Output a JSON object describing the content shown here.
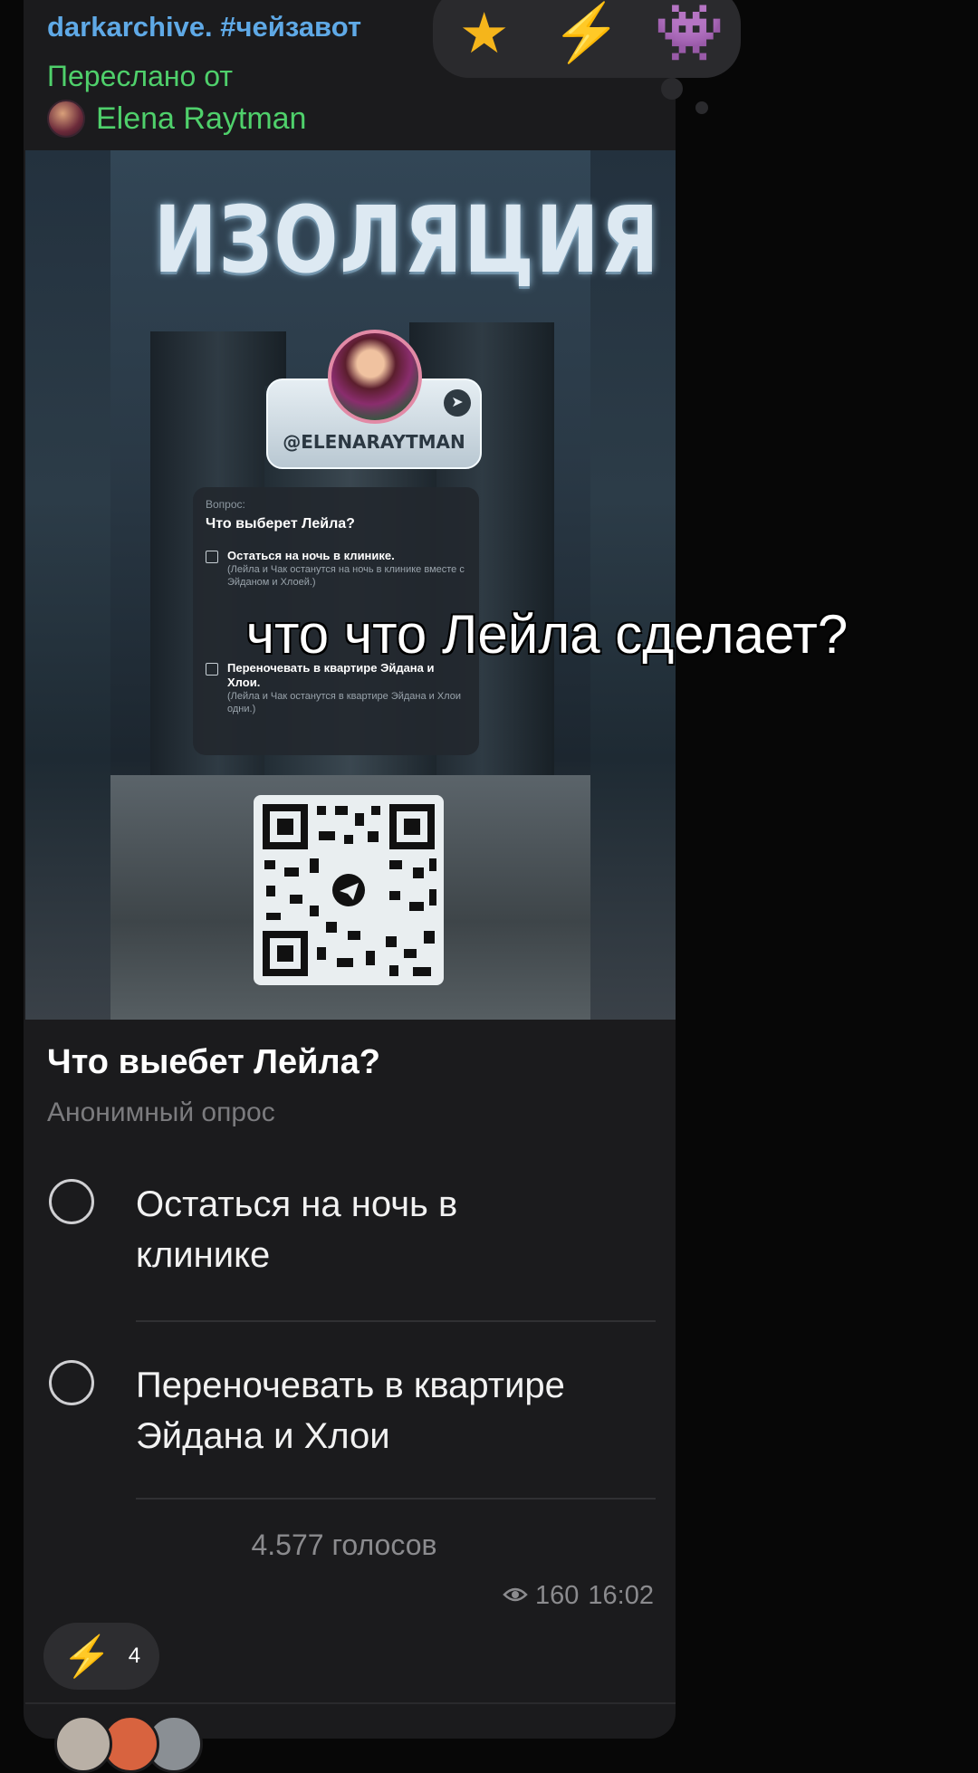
{
  "message": {
    "channel": "darkarchive. #чейзавот",
    "forwarded_label": "Переслано от",
    "author": "Elena Raytman"
  },
  "reaction_bar": {
    "items": [
      {
        "icon": "star-emoji",
        "glyph": "★"
      },
      {
        "icon": "high-voltage-emoji",
        "glyph": "⚡"
      },
      {
        "icon": "space-invader-emoji",
        "glyph": "👾"
      }
    ]
  },
  "poster": {
    "title": "ИЗОЛЯЦИЯ",
    "handle": "@ELENARAYTMAN",
    "mini_poll": {
      "label": "Вопрос:",
      "question": "Что выберет Лейла?",
      "options": [
        {
          "title": "Остаться на ночь в клинике.",
          "subtitle": "(Лейла и Чак останутся на ночь в клинике вместе с Эйданом и Хлоей.)"
        },
        {
          "title": "Переночевать в квартире Эйдана и Хлои.",
          "subtitle": "(Лейла и Чак останутся в квартире Эйдана и Хлои одни.)"
        }
      ]
    }
  },
  "overlay_caption": "что что Лейла сделает?",
  "poll": {
    "question": "Что выебет Лейла?",
    "type": "Анонимный опрос",
    "options": [
      {
        "line1": "Остаться на ночь в",
        "line2": "клинике"
      },
      {
        "line1": "Переночевать в квартире",
        "line2": "Эйдана и Хлои"
      }
    ],
    "votes": "4.577 голосов"
  },
  "meta": {
    "views": "160",
    "time": "16:02"
  },
  "reaction": {
    "icon": "high-voltage-emoji",
    "glyph": "⚡",
    "count": "4"
  },
  "colors": {
    "channel": "#5fa9e6",
    "forwarded": "#4fd06b",
    "bubble": "#1b1b1d",
    "background": "#070707"
  }
}
